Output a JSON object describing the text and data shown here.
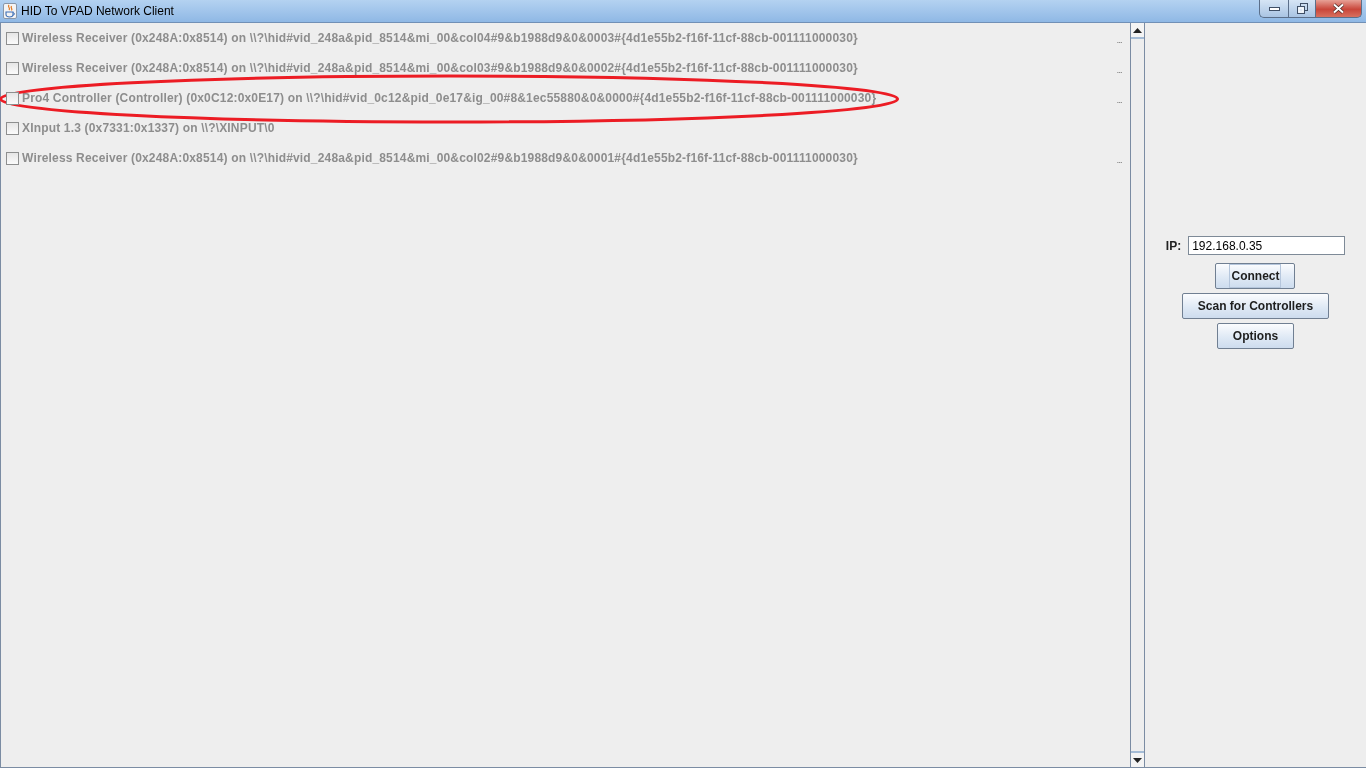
{
  "window": {
    "title": "HID To VPAD Network Client"
  },
  "devices": [
    {
      "label": "Wireless Receiver (0x248A:0x8514) on \\\\?\\hid#vid_248a&pid_8514&mi_00&col04#9&b1988d9&0&0003#{4d1e55b2-f16f-11cf-88cb-001111000030}",
      "checked": false,
      "disabled": true,
      "highlighted": false,
      "trailing_text": "..."
    },
    {
      "label": "Wireless Receiver (0x248A:0x8514) on \\\\?\\hid#vid_248a&pid_8514&mi_00&col03#9&b1988d9&0&0002#{4d1e55b2-f16f-11cf-88cb-001111000030}",
      "checked": false,
      "disabled": true,
      "highlighted": false,
      "trailing_text": "..."
    },
    {
      "label": "Pro4 Controller (Controller) (0x0C12:0x0E17) on \\\\?\\hid#vid_0c12&pid_0e17&ig_00#8&1ec55880&0&0000#{4d1e55b2-f16f-11cf-88cb-001111000030}",
      "checked": false,
      "disabled": true,
      "highlighted": true,
      "trailing_text": "..."
    },
    {
      "label": "XInput 1.3 (0x7331:0x1337) on \\\\?\\XINPUT\\0",
      "checked": false,
      "disabled": true,
      "highlighted": false
    },
    {
      "label": "Wireless Receiver (0x248A:0x8514) on \\\\?\\hid#vid_248a&pid_8514&mi_00&col02#9&b1988d9&0&0001#{4d1e55b2-f16f-11cf-88cb-001111000030}",
      "checked": false,
      "disabled": true,
      "highlighted": false,
      "trailing_text": "..."
    }
  ],
  "connection": {
    "ip_label": "IP:",
    "ip_value": "192.168.0.35"
  },
  "buttons": [
    {
      "label": "Connect",
      "focused": true
    },
    {
      "label": "Scan for Controllers",
      "focused": false
    },
    {
      "label": "Options",
      "focused": false
    }
  ]
}
